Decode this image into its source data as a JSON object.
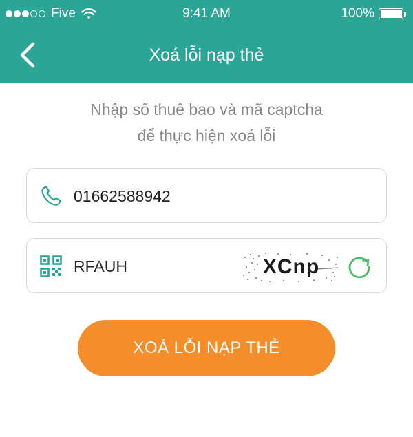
{
  "status_bar": {
    "carrier": "Five",
    "time": "9:41 AM",
    "battery": "100%",
    "signal_filled": 3,
    "signal_total": 5
  },
  "nav": {
    "title": "Xoá lỗi nạp thẻ",
    "back_icon": "chevron-left-icon"
  },
  "instruction": {
    "line1": "Nhập số thuê bao và mã captcha",
    "line2": "để thực hiện xoá lỗi"
  },
  "phone_field": {
    "icon": "phone-icon",
    "value": "01662588942"
  },
  "captcha_field": {
    "icon": "qr-code-icon",
    "value": "RFAUH",
    "captcha_text": "XCnp",
    "refresh_icon": "refresh-icon"
  },
  "submit": {
    "label": "XOÁ LỖI NẠP THẺ"
  },
  "colors": {
    "header": "#2aa596",
    "accent_icon": "#2aa596",
    "refresh": "#4cbb6a",
    "button": "#f58d2b",
    "instruction_text": "#888888"
  }
}
